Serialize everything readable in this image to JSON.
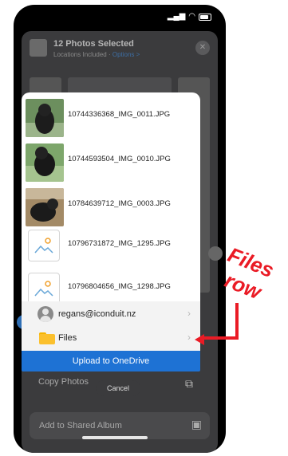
{
  "share_sheet": {
    "title": "12 Photos Selected",
    "subtitle": "Locations Included",
    "options_label": "Options >",
    "close_glyph": "✕",
    "copy_photos_label": "Copy Photos",
    "add_album_label": "Add to Shared Album"
  },
  "onedrive_picker": {
    "files": [
      {
        "name": "10744336368_IMG_0011.JPG",
        "thumb": "dog-photo"
      },
      {
        "name": "10744593504_IMG_0010.JPG",
        "thumb": "dog-photo"
      },
      {
        "name": "10784639712_IMG_0003.JPG",
        "thumb": "dog-photo"
      },
      {
        "name": "10796731872_IMG_1295.JPG",
        "thumb": "placeholder"
      },
      {
        "name": "10796804656_IMG_1298.JPG",
        "thumb": "placeholder"
      }
    ],
    "account_label": "regans@iconduit.nz",
    "files_label": "Files",
    "upload_label": "Upload to OneDrive",
    "cancel_label": "Cancel",
    "chevron": "›"
  },
  "annotation": {
    "line1": "Files",
    "line2": "row",
    "color": "#ea1b25"
  },
  "colors": {
    "accent": "#1e72d4",
    "folder": "#fbc02d"
  }
}
